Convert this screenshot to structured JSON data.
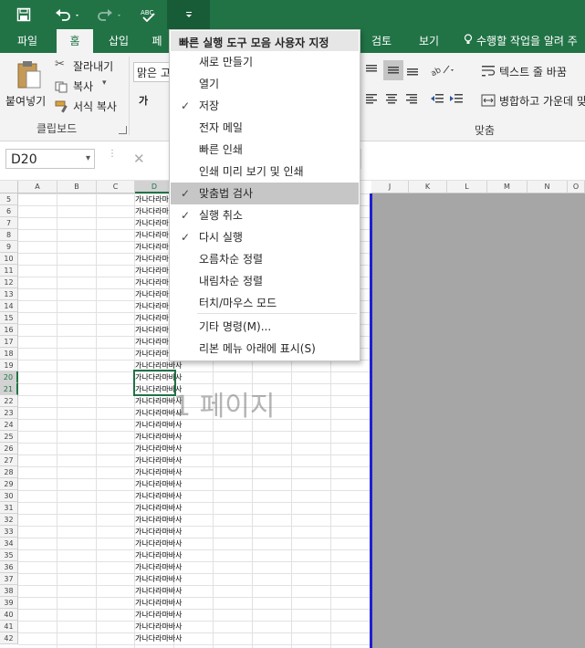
{
  "quick_access": {
    "save_icon": "save-icon",
    "undo_icon": "undo-icon",
    "redo_icon": "redo-icon",
    "spellcheck_icon": "spellcheck-icon",
    "customize_icon": "customize-dropdown-icon"
  },
  "tabs": [
    "파일",
    "홈",
    "삽입",
    "페",
    "검토",
    "보기"
  ],
  "tell_me": "수행할 작업을 알려 주",
  "ribbon": {
    "paste": "붙여넣기",
    "cut": "잘라내기",
    "copy": "복사",
    "format_painter": "서식 복사",
    "clipboard_group": "클립보드",
    "font_name": "맑은 고",
    "bold_hint": "가",
    "wrap_text": "텍스트 줄 바꿈",
    "merge_center": "병합하고 가운데 맞",
    "alignment_group": "맞춤"
  },
  "formula_bar": {
    "name_box": "D20",
    "cancel": "✕"
  },
  "grid": {
    "columns_left": [
      "A",
      "B",
      "C",
      "D"
    ],
    "columns_right": [
      "J",
      "K",
      "L",
      "M",
      "N",
      "O"
    ],
    "rows": [
      "5",
      "6",
      "7",
      "8",
      "9",
      "10",
      "11",
      "12",
      "13",
      "14",
      "15",
      "16",
      "17",
      "18",
      "19",
      "20",
      "21",
      "22",
      "23",
      "24",
      "25",
      "26",
      "27",
      "28",
      "29",
      "30",
      "31",
      "32",
      "33",
      "34",
      "35",
      "36",
      "37",
      "38",
      "39",
      "40",
      "41",
      "42"
    ],
    "cell_text": "가나다라마바사",
    "page_watermark": "1 페이지"
  },
  "menu": {
    "title": "빠른 실행 도구 모음 사용자 지정",
    "items": [
      {
        "label": "새로 만들기",
        "checked": false
      },
      {
        "label": "열기",
        "checked": false
      },
      {
        "label": "저장",
        "checked": true
      },
      {
        "label": "전자 메일",
        "checked": false
      },
      {
        "label": "빠른 인쇄",
        "checked": false
      },
      {
        "label": "인쇄 미리 보기 및 인쇄",
        "checked": false
      },
      {
        "label": "맞춤법 검사",
        "checked": true
      },
      {
        "label": "실행 취소",
        "checked": true
      },
      {
        "label": "다시 실행",
        "checked": true
      },
      {
        "label": "오름차순 정렬",
        "checked": false
      },
      {
        "label": "내림차순 정렬",
        "checked": false
      },
      {
        "label": "터치/마우스 모드",
        "checked": false
      }
    ],
    "more_commands": "기타 명령(M)...",
    "show_below": "리본 메뉴 아래에 표시(S)"
  }
}
